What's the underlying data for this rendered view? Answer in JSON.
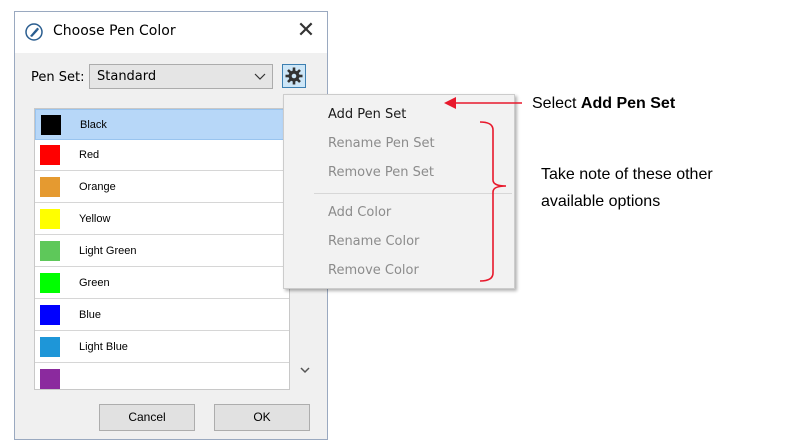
{
  "dialog": {
    "title": "Choose Pen Color",
    "close_symbol": "✕",
    "pen_set_label": "Pen Set:",
    "pen_set_value": "Standard",
    "gear_icon": "gear-icon",
    "colors": [
      {
        "name": "Black",
        "hex": "#000000",
        "selected": true
      },
      {
        "name": "Red",
        "hex": "#ff0000"
      },
      {
        "name": "Orange",
        "hex": "#e59a30"
      },
      {
        "name": "Yellow",
        "hex": "#ffff00"
      },
      {
        "name": "Light Green",
        "hex": "#5ec85a"
      },
      {
        "name": "Green",
        "hex": "#00ff00"
      },
      {
        "name": "Blue",
        "hex": "#0000ff"
      },
      {
        "name": "Light Blue",
        "hex": "#1e96d8"
      },
      {
        "name": "",
        "hex": "#8b2a9e"
      }
    ],
    "cancel_label": "Cancel",
    "ok_label": "OK"
  },
  "context_menu": {
    "items": [
      {
        "label": "Add Pen Set",
        "enabled": true
      },
      {
        "label": "Rename Pen Set",
        "enabled": false
      },
      {
        "label": "Remove Pen Set",
        "enabled": false
      },
      {
        "label": "Add Color",
        "enabled": false
      },
      {
        "label": "Rename Color",
        "enabled": false
      },
      {
        "label": "Remove Color",
        "enabled": false
      }
    ]
  },
  "annotations": {
    "select_prefix": "Select ",
    "select_bold": "Add Pen Set",
    "note_line1": "Take note of these other",
    "note_line2": "available options",
    "arrow_color": "#e8192c",
    "bracket_color": "#e8192c"
  },
  "colors": {
    "selection_bg": "#b7d7f8",
    "gear_bg": "#cde6f7",
    "dialog_bg": "#f0f0f0"
  }
}
